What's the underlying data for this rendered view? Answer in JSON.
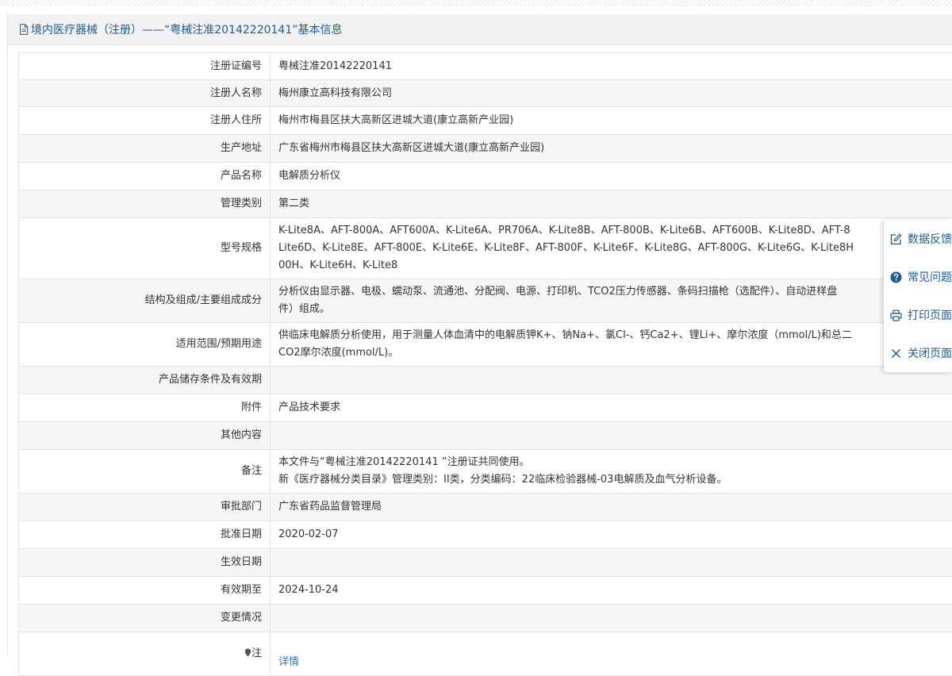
{
  "panel": {
    "title": "境内医疗器械（注册）——“粤械注准20142220141”基本信息"
  },
  "rows": [
    {
      "label": "注册证编号",
      "value": "粤械注准20142220141"
    },
    {
      "label": "注册人名称",
      "value": "梅州康立高科技有限公司"
    },
    {
      "label": "注册人住所",
      "value": "梅州市梅县区扶大高新区进城大道(康立高新产业园)"
    },
    {
      "label": "生产地址",
      "value": "广东省梅州市梅县区扶大高新区进城大道(康立高新产业园)"
    },
    {
      "label": "产品名称",
      "value": "电解质分析仪"
    },
    {
      "label": "管理类别",
      "value": "第二类"
    },
    {
      "label": "型号规格",
      "value": "K-Lite8A、AFT-800A、AFT600A、K-Lite6A、PR706A、K-Lite8B、AFT-800B、K-Lite6B、AFT600B、K-Lite8D、AFT-8\nLite6D、K-Lite8E、AFT-800E、K-Lite6E、K-Lite8F、AFT-800F、K-Lite6F、K-Lite8G、AFT-800G、K-Lite6G、K-Lite8H\n00H、K-Lite6H、K-Lite8"
    },
    {
      "label": "结构及组成/主要组成成分",
      "value": "分析仪由显示器、电极、蠕动泵、流通池、分配阀、电源、打印机、TCO2压力传感器、条码扫描枪（选配件）、自动进样盘\n件）组成。"
    },
    {
      "label": "适用范围/预期用途",
      "value": "供临床电解质分析使用，用于测量人体血清中的电解质钾K+、钠Na+、氯Cl-、钙Ca2+、锂Li+、摩尔浓度（mmol/L)和总二\nCO2摩尔浓度(mmol/L)。"
    },
    {
      "label": "产品储存条件及有效期",
      "value": ""
    },
    {
      "label": "附件",
      "value": "产品技术要求"
    },
    {
      "label": "其他内容",
      "value": ""
    },
    {
      "label": "备注",
      "value": "本文件与“粤械注准20142220141 ”注册证共同使用。\n新《医疗器械分类目录》管理类别：II类，分类编码：22临床检验器械-03电解质及血气分析设备。"
    },
    {
      "label": "审批部门",
      "value": "广东省药品监督管理局"
    },
    {
      "label": "批准日期",
      "value": "2020-02-07"
    },
    {
      "label": "生效日期",
      "value": ""
    },
    {
      "label": "有效期至",
      "value": "2024-10-24"
    },
    {
      "label": "变更情况",
      "value": ""
    }
  ],
  "note_row": {
    "label": "注",
    "link_text": "详情"
  },
  "side_menu": [
    {
      "label": "数据反馈",
      "icon": "edit-icon"
    },
    {
      "label": "常见问题",
      "icon": "question-icon"
    },
    {
      "label": "打印页面",
      "icon": "print-icon"
    },
    {
      "label": "关闭页面",
      "icon": "close-icon"
    }
  ],
  "colors": {
    "accent": "#1f5a96",
    "link": "#2f76c1",
    "header_bg": "#f2f2f2",
    "alt_row_bg": "#f6f6f6",
    "border": "#e3e3e3"
  }
}
